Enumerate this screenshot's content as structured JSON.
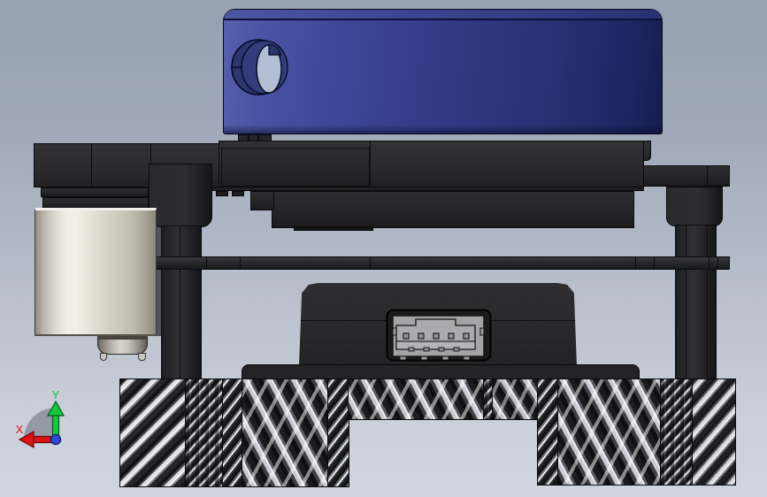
{
  "viewport": {
    "type": "3d-cad-model-view",
    "background_top": "#97a1b1",
    "background_bottom": "#d0d5df"
  },
  "orientation_triad": {
    "x_label": "X",
    "y_label": "Y",
    "x_axis_color": "#d81414",
    "y_axis_color": "#12c93e",
    "origin_color": "#2b4ed6"
  },
  "model_colors": {
    "top_cover_blue_light": "#5660ac",
    "top_cover_blue_dark": "#171d50",
    "housing_dark": "#28282a",
    "motor_body_beige": "#f0ede5",
    "connector_gray": "#a6a6a6",
    "base_knurl_silver": "#eceef1",
    "base_knurl_black": "#121214"
  }
}
